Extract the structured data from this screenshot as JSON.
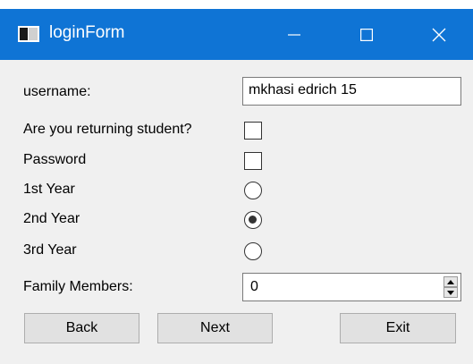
{
  "window": {
    "title": "loginForm",
    "title_color": "#0f74d5"
  },
  "titlebar_buttons": {
    "minimize": "minimize-icon",
    "maximize": "maximize-icon",
    "close": "close-icon"
  },
  "form": {
    "username_label": "username:",
    "username_value": "mkhasi edrich 15",
    "returning_label": "Are you returning student?",
    "returning_checked": false,
    "password_label": "Password",
    "password_checked": false,
    "year_options": [
      {
        "label": "1st Year",
        "checked": false
      },
      {
        "label": "2nd Year",
        "checked": true
      },
      {
        "label": "3rd Year",
        "checked": false
      }
    ],
    "family_label": "Family Members:",
    "family_value": "0"
  },
  "buttons": {
    "back": "Back",
    "next": "Next",
    "exit": "Exit"
  }
}
